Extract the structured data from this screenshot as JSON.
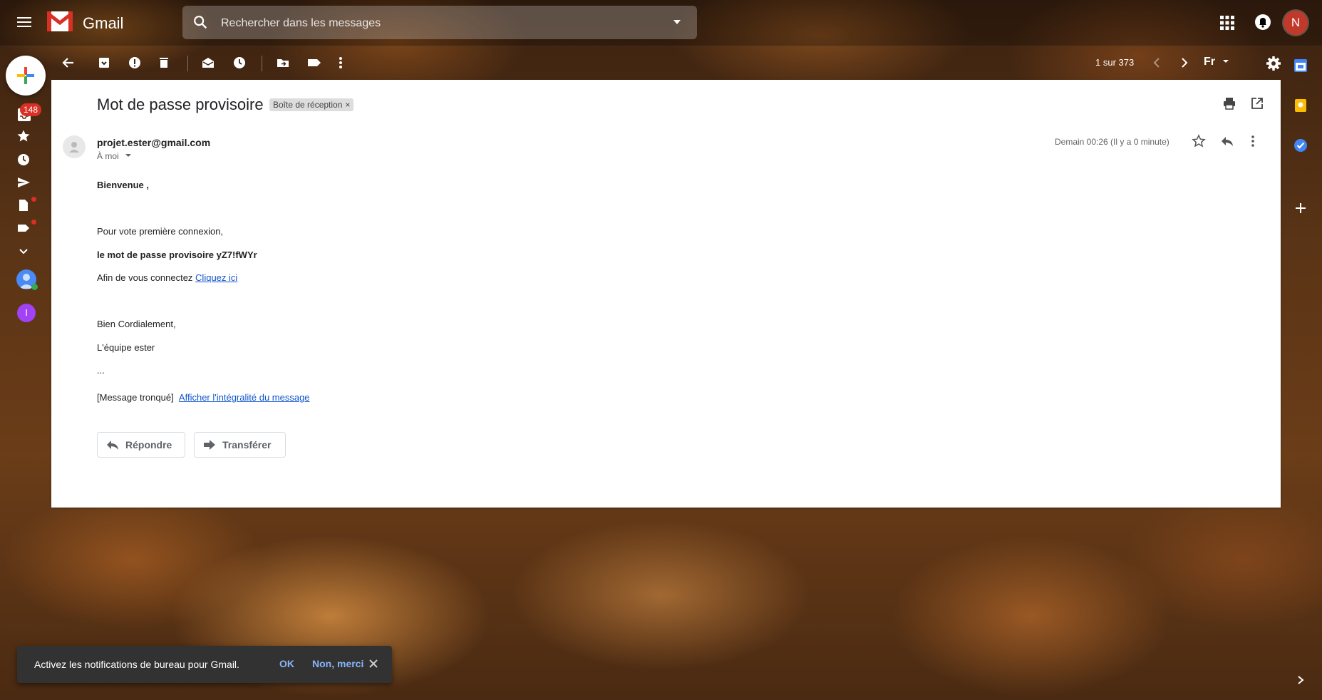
{
  "header": {
    "app_name": "Gmail",
    "search_placeholder": "Rechercher dans les messages",
    "avatar_initial": "N"
  },
  "toolbar": {
    "pager": "1 sur 373",
    "language": "Fr"
  },
  "sidebar": {
    "inbox_badge": "148",
    "secondary_avatar_initial": "I"
  },
  "email": {
    "subject": "Mot de passe provisoire",
    "label": "Boîte de réception",
    "label_remove": "×",
    "sender": "projet.ester@gmail.com",
    "recipient": "À moi",
    "date": "Demain 00:26 (Il y a 0 minute)",
    "body": {
      "greeting": "Bienvenue ,",
      "line1": "Pour vote première connexion,",
      "line2": "le mot de passe provisoire yZ7!fWYr",
      "line3": "Afin de vous connectez",
      "link": "Cliquez ici",
      "closing": "Bien Cordialement,",
      "signature": "L'équipe ester",
      "ellipsis": "...",
      "truncated": "[Message tronqué]",
      "full_message_link": "Afficher l'intégralité du message"
    },
    "reply_button": "Répondre",
    "forward_button": "Transférer"
  },
  "toast": {
    "message": "Activez les notifications de bureau pour Gmail.",
    "ok": "OK",
    "no": "Non, merci"
  }
}
